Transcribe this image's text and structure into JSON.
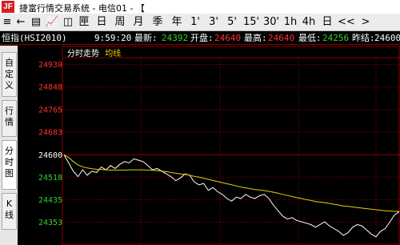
{
  "window": {
    "title": "捷富行情交易系统 - 电信01 - 【"
  },
  "toolbar": {
    "buttons": [
      {
        "label": "≡",
        "name": "menu-list-icon",
        "interactable": true
      },
      {
        "label": "←",
        "name": "back-arrow-icon",
        "interactable": true
      },
      {
        "label": "▤",
        "name": "quote-list-icon",
        "interactable": true
      },
      {
        "label": "📈",
        "name": "line-chart-icon",
        "interactable": true
      },
      {
        "label": "◫",
        "name": "tick-detail-icon",
        "interactable": true
      },
      {
        "label": "匣",
        "name": "f10-icon",
        "interactable": true
      },
      {
        "label": "日",
        "name": "period-day-button",
        "interactable": true
      },
      {
        "label": "周",
        "name": "period-week-button",
        "interactable": true
      },
      {
        "label": "月",
        "name": "period-month-button",
        "interactable": true
      },
      {
        "label": "季",
        "name": "period-quarter-button",
        "interactable": true
      },
      {
        "label": "年",
        "name": "period-year-button",
        "interactable": true
      },
      {
        "label": "1'",
        "name": "period-1min-button",
        "interactable": true
      },
      {
        "label": "3'",
        "name": "period-3min-button",
        "interactable": true
      },
      {
        "label": "5'",
        "name": "period-5min-button",
        "interactable": true
      },
      {
        "label": "15'",
        "name": "period-15min-button",
        "interactable": true
      },
      {
        "label": "30'",
        "name": "period-30min-button",
        "interactable": true
      },
      {
        "label": "1h",
        "name": "period-1h-button",
        "interactable": true
      },
      {
        "label": "4h",
        "name": "period-4h-button",
        "interactable": true
      },
      {
        "label": "日",
        "name": "period-day2-button",
        "interactable": true
      },
      {
        "label": "<<",
        "name": "prev-double-icon",
        "interactable": true
      },
      {
        "label": ">",
        "name": "next-icon",
        "interactable": true
      }
    ]
  },
  "info": {
    "name": "恒指(HSI2010)",
    "time": "9:59:20",
    "latest_label": "最新:",
    "latest": "24392",
    "open_label": "开盘:",
    "open": "24640",
    "high_label": "最高:",
    "high": "24640",
    "low_label": "最低:",
    "low": "24256",
    "prev_label": "昨结:",
    "prev": "24600"
  },
  "side_tabs": [
    {
      "label": "自定义",
      "name": "tab-custom",
      "active": false
    },
    {
      "label": "行情",
      "name": "tab-quote",
      "active": false
    },
    {
      "label": "分时图",
      "name": "tab-timeshare",
      "active": true
    },
    {
      "label": "K线",
      "name": "tab-kline",
      "active": false
    }
  ],
  "chart_header": {
    "title": "分时走势",
    "avg_label": "均线"
  },
  "colors": {
    "up": "#ff3030",
    "down": "#30d030",
    "grid": "#8b0000",
    "price_line": "#ffffff",
    "avg_line": "#e6d200",
    "yellow_text": "#e6d200"
  },
  "chart_data": {
    "type": "line",
    "title": "分时走势",
    "ylim": [
      24270,
      24955
    ],
    "y_ticks": [
      24930,
      24848,
      24765,
      24683,
      24600,
      24518,
      24435,
      24353
    ],
    "reference": 24600,
    "series": [
      {
        "name": "",
        "color": "#ffffff",
        "values": [
          24600,
          24570,
          24540,
          24520,
          24545,
          24525,
          24540,
          24535,
          24555,
          24545,
          24560,
          24550,
          24565,
          24575,
          24570,
          24585,
          24580,
          24575,
          24560,
          24545,
          24550,
          24540,
          24530,
          24520,
          24505,
          24515,
          24530,
          24525,
          24500,
          24490,
          24495,
          24470,
          24480,
          24465,
          24455,
          24440,
          24430,
          24445,
          24440,
          24455,
          24445,
          24440,
          24450,
          24455,
          24440,
          24415,
          24395,
          24375,
          24365,
          24370,
          24360,
          24355,
          24350,
          24345,
          24335,
          24345,
          24355,
          24340,
          24330,
          24320,
          24305,
          24315,
          24335,
          24345,
          24340,
          24325,
          24310,
          24300,
          24320,
          24330,
          24355,
          24380,
          24392
        ]
      },
      {
        "name": "均线",
        "color": "#e6d200",
        "values": [
          24600,
          24590,
          24575,
          24563,
          24556,
          24552,
          24549,
          24547,
          24546,
          24545,
          24544,
          24544,
          24544,
          24544,
          24545,
          24545,
          24545,
          24545,
          24544,
          24543,
          24542,
          24540,
          24538,
          24535,
          24533,
          24530,
          24528,
          24525,
          24521,
          24518,
          24514,
          24510,
          24506,
          24502,
          24498,
          24494,
          24490,
          24486,
          24482,
          24479,
          24476,
          24473,
          24471,
          24469,
          24466,
          24463,
          24459,
          24455,
          24451,
          24447,
          24443,
          24440,
          24436,
          24433,
          24429,
          24427,
          24425,
          24422,
          24419,
          24416,
          24413,
          24411,
          24409,
          24407,
          24405,
          24403,
          24401,
          24399,
          24397,
          24395,
          24394,
          24393,
          24393
        ]
      }
    ]
  }
}
